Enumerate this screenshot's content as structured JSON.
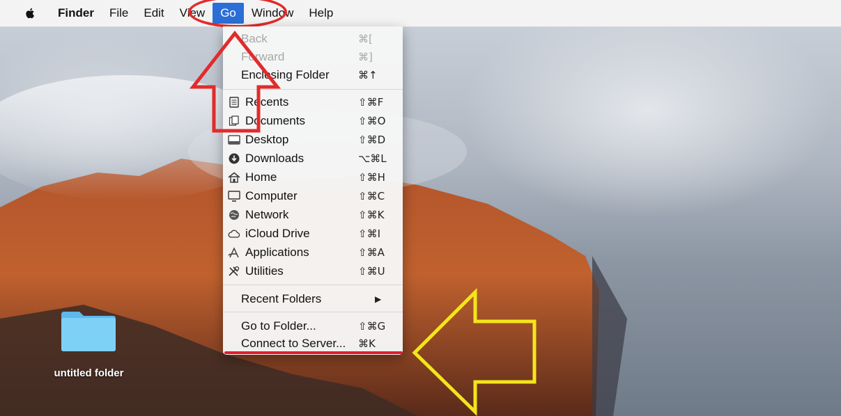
{
  "menubar": {
    "app_name": "Finder",
    "items": [
      "File",
      "Edit",
      "View",
      "Go",
      "Window",
      "Help"
    ],
    "active_item": "Go"
  },
  "go_menu": {
    "back": {
      "label": "Back",
      "shortcut": "⌘["
    },
    "forward": {
      "label": "Forward",
      "shortcut": "⌘]"
    },
    "enclosing": {
      "label": "Enclosing Folder",
      "shortcut": "⌘↑"
    },
    "recents": {
      "label": "Recents",
      "shortcut": "⇧⌘F"
    },
    "documents": {
      "label": "Documents",
      "shortcut": "⇧⌘O"
    },
    "desktop": {
      "label": "Desktop",
      "shortcut": "⇧⌘D"
    },
    "downloads": {
      "label": "Downloads",
      "shortcut": "⌥⌘L"
    },
    "home": {
      "label": "Home",
      "shortcut": "⇧⌘H"
    },
    "computer": {
      "label": "Computer",
      "shortcut": "⇧⌘C"
    },
    "network": {
      "label": "Network",
      "shortcut": "⇧⌘K"
    },
    "icloud": {
      "label": "iCloud Drive",
      "shortcut": "⇧⌘I"
    },
    "applications": {
      "label": "Applications",
      "shortcut": "⇧⌘A"
    },
    "utilities": {
      "label": "Utilities",
      "shortcut": "⇧⌘U"
    },
    "recent_folders": {
      "label": "Recent Folders",
      "shortcut": "▶"
    },
    "go_to_folder": {
      "label": "Go to Folder...",
      "shortcut": "⇧⌘G"
    },
    "connect_server": {
      "label": "Connect to Server...",
      "shortcut": "⌘K"
    }
  },
  "desktop": {
    "folder_label": "untitled folder"
  },
  "colors": {
    "menu_highlight": "#2b6fd6",
    "annotation_red": "#e12b2b",
    "annotation_yellow": "#f4e51b",
    "folder_blue": "#6cc4f2"
  }
}
